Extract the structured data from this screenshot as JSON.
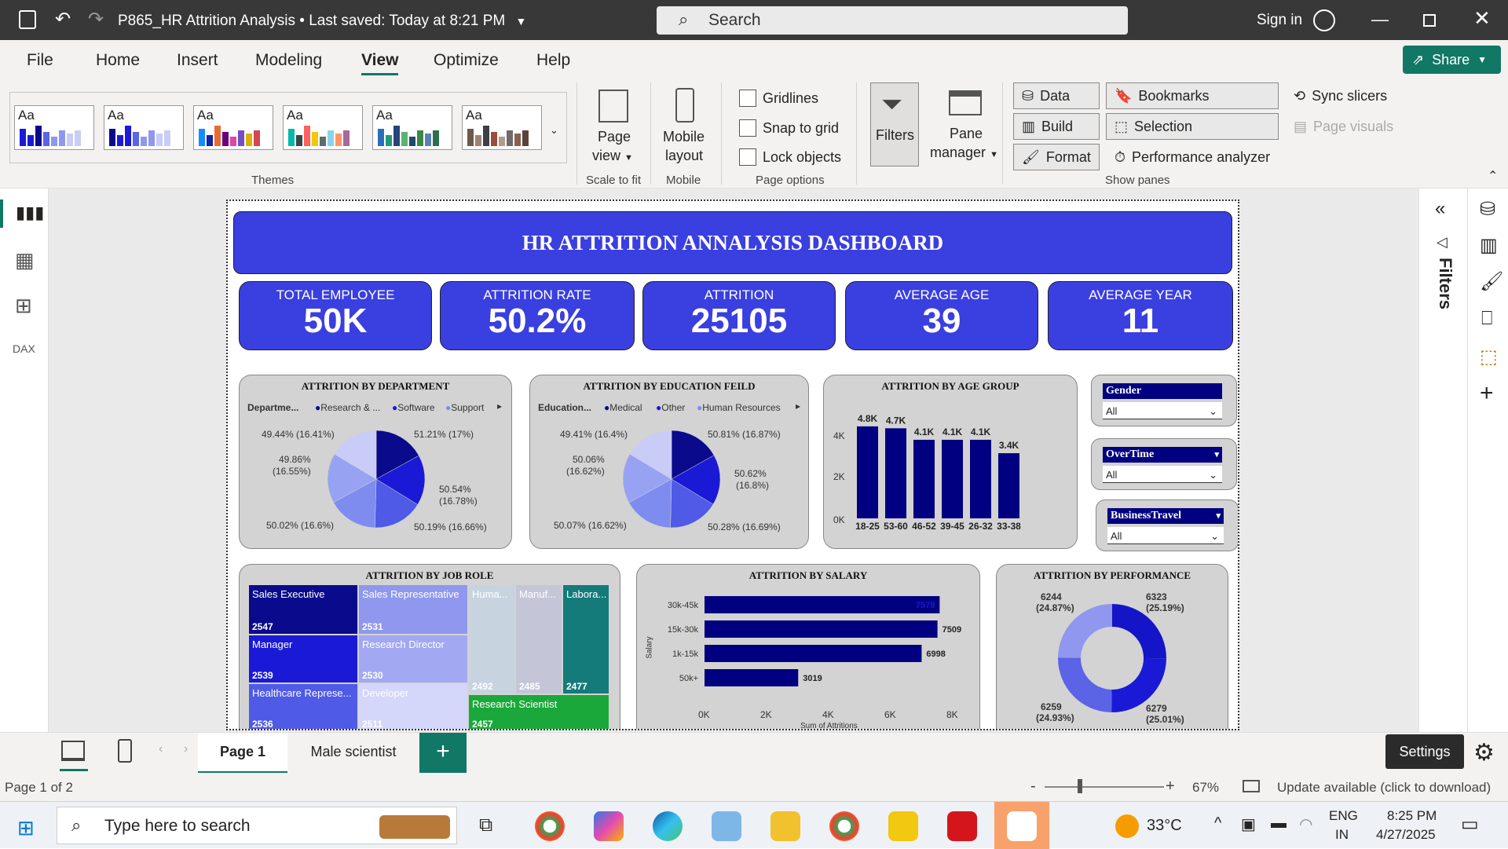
{
  "titlebar": {
    "doc_title": "P865_HR Attrition Analysis",
    "saved": "Last saved: Today at 8:21 PM",
    "search": "Search",
    "sign_in": "Sign in"
  },
  "menu": [
    "File",
    "Home",
    "Insert",
    "Modeling",
    "View",
    "Optimize",
    "Help"
  ],
  "share": "Share",
  "ribbon": {
    "themes_label": "Themes",
    "theme_aa": "Aa",
    "page_view": "Page",
    "page_view2": "view",
    "scale_label": "Scale to fit",
    "mobile1": "Mobile",
    "mobile2": "layout",
    "mobile_label": "Mobile",
    "gridlines": "Gridlines",
    "snap": "Snap to grid",
    "lock": "Lock objects",
    "page_options_label": "Page options",
    "filters": "Filters",
    "pane1": "Pane",
    "pane2": "manager",
    "data": "Data",
    "build": "Build",
    "format": "Format",
    "bookmarks": "Bookmarks",
    "selection": "Selection",
    "perf": "Performance analyzer",
    "sync": "Sync slicers",
    "page_visuals": "Page visuals",
    "show_panes_label": "Show panes"
  },
  "dashboard": {
    "title": "HR ATTRITION ANNALYSIS DASHBOARD",
    "kpis": [
      {
        "label": "TOTAL EMPLOYEE",
        "value": "50K"
      },
      {
        "label": "ATTRITION RATE",
        "value": "50.2%"
      },
      {
        "label": "ATTRITION",
        "value": "25105"
      },
      {
        "label": "AVERAGE AGE",
        "value": "39"
      },
      {
        "label": "AVERAGE YEAR",
        "value": "11"
      }
    ],
    "dept": {
      "title": "ATTRITION BY DEPARTMENT",
      "legend_title": "Departme...",
      "legend": [
        "Research & ...",
        "Software",
        "Support"
      ],
      "labels": [
        "49.44% (16.41%)",
        "51.21% (17%)",
        "49.86%",
        "(16.55%)",
        "50.54%",
        "(16.78%)",
        "50.02% (16.6%)",
        "50.19% (16.66%)"
      ]
    },
    "edu": {
      "title": "ATTRITION BY EDUCATION FEILD",
      "legend_title": "Education...",
      "legend": [
        "Medical",
        "Other",
        "Human Resources"
      ],
      "labels": [
        "49.41% (16.4%)",
        "50.81% (16.87%)",
        "50.06%",
        "(16.62%)",
        "50.62%",
        "(16.8%)",
        "50.07% (16.62%)",
        "50.28% (16.69%)"
      ]
    },
    "age": {
      "title": "ATTRITION BY AGE GROUP",
      "yticks": [
        "4K",
        "2K",
        "0K"
      ]
    },
    "slicers": [
      {
        "label": "Gender",
        "value": "All"
      },
      {
        "label": "OverTime",
        "value": "All"
      },
      {
        "label": "BusinessTravel",
        "value": "All"
      }
    ],
    "jobrole": {
      "title": "ATTRITION BY JOB ROLE",
      "items": [
        {
          "name": "Sales Executive",
          "value": "2547"
        },
        {
          "name": "Sales Representative",
          "value": "2531"
        },
        {
          "name": "Huma...",
          "value": "2492"
        },
        {
          "name": "Manuf...",
          "value": "2485"
        },
        {
          "name": "Labora...",
          "value": "2477"
        },
        {
          "name": "Manager",
          "value": "2539"
        },
        {
          "name": "Research Director",
          "value": "2530"
        },
        {
          "name": "Healthcare Represe...",
          "value": "2536"
        },
        {
          "name": "Developer",
          "value": "2511"
        },
        {
          "name": "Research Scientist",
          "value": "2457"
        }
      ]
    },
    "salary": {
      "title": "ATTRITION BY SALARY",
      "ylabel": "Salary",
      "xlabel": "Sum of Attritions",
      "xticks": [
        "0K",
        "2K",
        "4K",
        "6K",
        "8K"
      ]
    },
    "perf": {
      "title": "ATTRITION BY PERFORMANCE",
      "labels": [
        "6244",
        "(24.87%)",
        "6323",
        "(25.19%)",
        "6259",
        "(24.93%)",
        "6279",
        "(25.01%)"
      ]
    }
  },
  "right_pane": {
    "filters": "Filters"
  },
  "tabs": [
    "Page 1",
    "Male scientist"
  ],
  "status": {
    "page": "Page 1 of 2",
    "zoom": "67%",
    "update": "Update available (click to download)",
    "settings": "Settings"
  },
  "taskbar": {
    "search": "Type here to search",
    "temp": "33°C",
    "lang1": "ENG",
    "lang2": "IN",
    "time": "8:25 PM",
    "date": "4/27/2025"
  },
  "colors": {
    "accent": "#3a3fe0",
    "navy": "#000080",
    "ribbon": "#f3f2f1"
  },
  "chart_data": [
    {
      "type": "bar",
      "title": "ATTRITION BY AGE GROUP",
      "categories": [
        "18-25",
        "53-60",
        "46-52",
        "39-45",
        "26-32",
        "33-38"
      ],
      "values": [
        4800,
        4700,
        4100,
        4100,
        4100,
        3400
      ],
      "data_labels": [
        "4.8K",
        "4.7K",
        "4.1K",
        "4.1K",
        "4.1K",
        "3.4K"
      ],
      "ylim": [
        0,
        5000
      ]
    },
    {
      "type": "bar",
      "orientation": "horizontal",
      "title": "ATTRITION BY SALARY",
      "categories": [
        "30k-45k",
        "15k-30k",
        "1k-15k",
        "50k+"
      ],
      "values": [
        7579,
        7509,
        6998,
        3019
      ],
      "xlabel": "Sum of Attritions",
      "ylabel": "Salary",
      "xlim": [
        0,
        8000
      ]
    },
    {
      "type": "pie",
      "title": "ATTRITION BY DEPARTMENT",
      "values": [
        17,
        16.78,
        16.66,
        16.6,
        16.55,
        16.41
      ],
      "colors": [
        "#0a0a8c",
        "#1a1ad6",
        "#4f5ae6",
        "#7f8cef",
        "#97a3f2",
        "#c9ccf7"
      ]
    },
    {
      "type": "pie",
      "title": "ATTRITION BY EDUCATION FEILD",
      "values": [
        16.87,
        16.8,
        16.69,
        16.62,
        16.62,
        16.4
      ],
      "colors": [
        "#0a0a8c",
        "#1a1ad6",
        "#4f5ae6",
        "#7f8cef",
        "#97a3f2",
        "#c9ccf7"
      ]
    },
    {
      "type": "pie",
      "donut": true,
      "title": "ATTRITION BY PERFORMANCE",
      "values": [
        6323,
        6279,
        6259,
        6244
      ],
      "colors": [
        "#1515c8",
        "#1a1ad6",
        "#5b63e6",
        "#8f98ee"
      ]
    }
  ]
}
